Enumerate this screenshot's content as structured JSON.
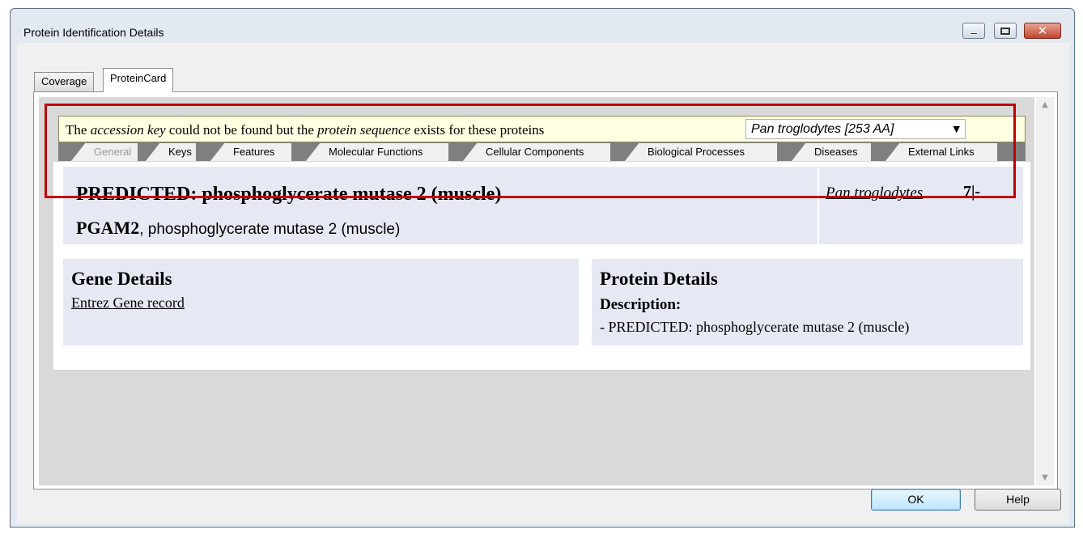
{
  "window": {
    "title": "Protein Identification Details",
    "colors": {
      "frame": "#e3e9f1",
      "close_button": "#c0452f"
    }
  },
  "tabs": [
    {
      "label": "Coverage",
      "selected": false
    },
    {
      "label": "ProteinCard",
      "selected": true
    }
  ],
  "notice": {
    "part1": "The ",
    "italic1": "accession key",
    "part2": " could not be found but the ",
    "italic2": "protein sequence",
    "part3": " exists for these proteins",
    "species_select": "Pan troglodytes [253 AA]"
  },
  "subtabs": [
    {
      "label": "General",
      "enabled": false
    },
    {
      "label": "Keys",
      "enabled": true
    },
    {
      "label": "Features",
      "enabled": true
    },
    {
      "label": "Molecular Functions",
      "enabled": true
    },
    {
      "label": "Cellular Components",
      "enabled": true
    },
    {
      "label": "Biological Processes",
      "enabled": true
    },
    {
      "label": "Diseases",
      "enabled": true
    },
    {
      "label": "External Links",
      "enabled": true
    }
  ],
  "card": {
    "title": "PREDICTED: phosphoglycerate mutase 2 (muscle)",
    "gene_symbol": "PGAM2",
    "gene_desc": ", phosphoglycerate mutase 2 (muscle)",
    "species_link": "Pan troglodytes",
    "species_extra": "7|-"
  },
  "gene_details": {
    "title": "Gene Details",
    "link": "Entrez Gene record"
  },
  "protein_details": {
    "title": "Protein Details",
    "desc_label": "Description:",
    "desc_value": "- PREDICTED: phosphoglycerate mutase 2 (muscle)"
  },
  "buttons": {
    "ok": "OK",
    "help": "Help"
  },
  "highlight_color": "#c00000"
}
